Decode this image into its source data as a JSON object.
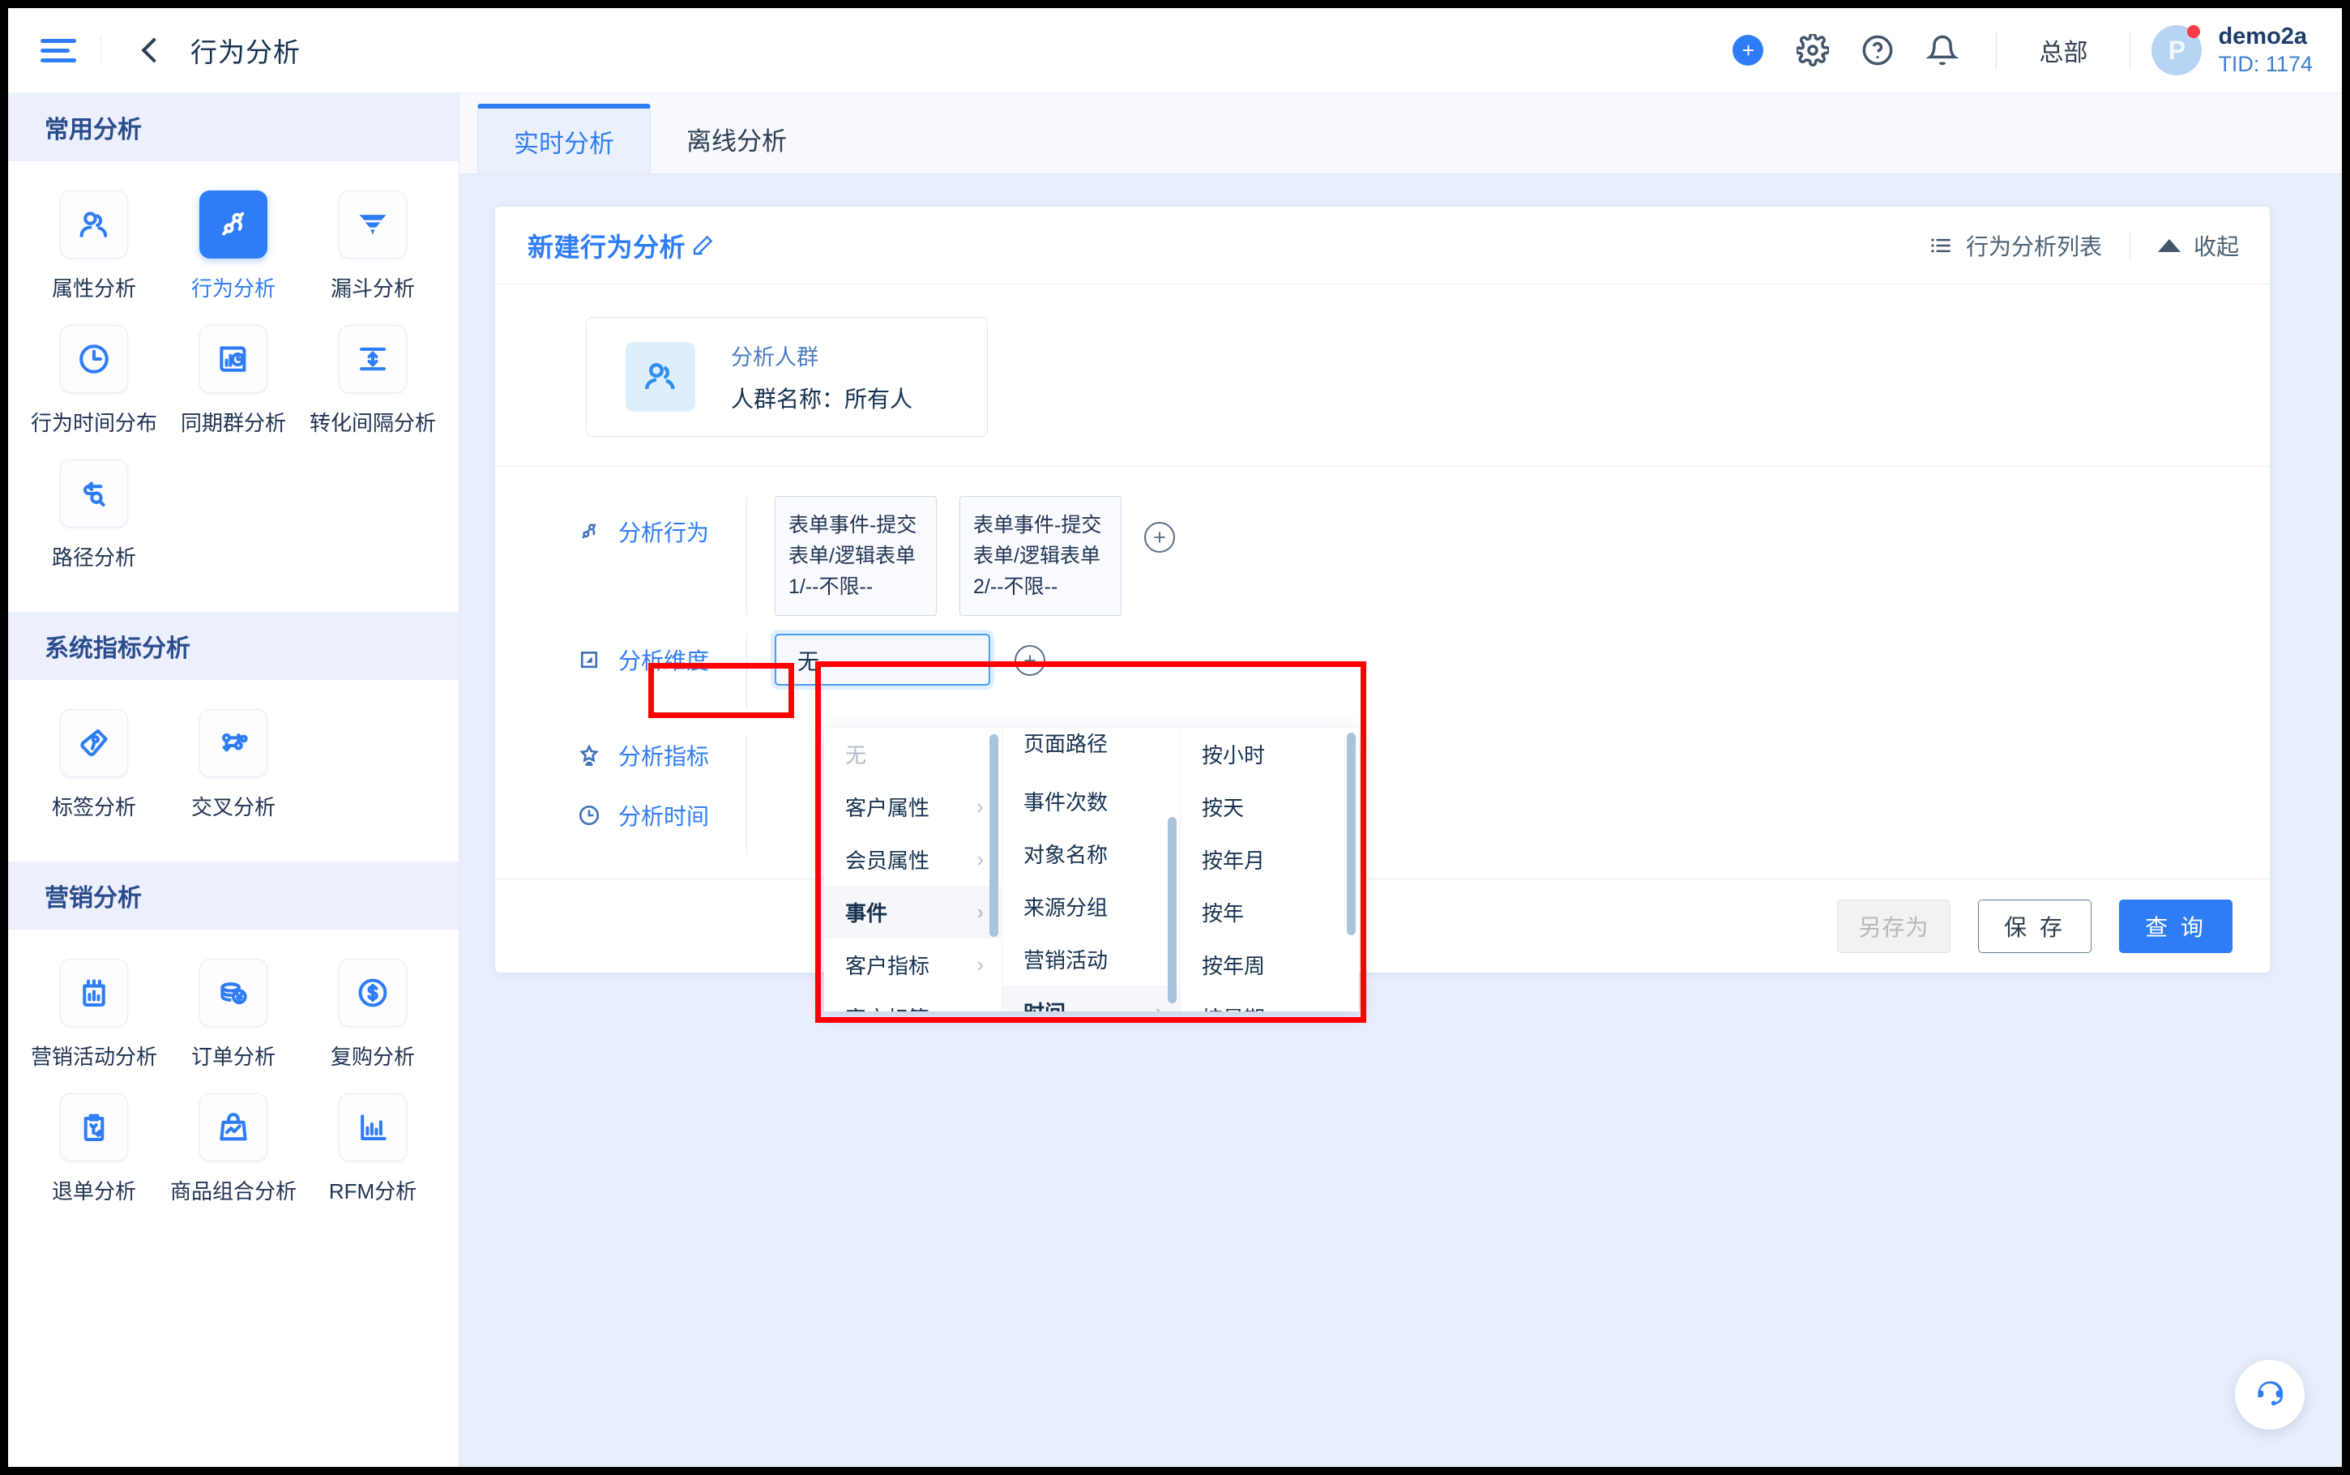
{
  "topbar": {
    "menu_icon": "hamburger-icon",
    "back_icon": "back-chevron-icon",
    "title": "行为分析",
    "icons": [
      "plus-circle-icon",
      "gear-icon",
      "help-icon",
      "bell-icon"
    ],
    "org_label": "总部",
    "user": {
      "avatar_letter": "P",
      "name": "demo2a",
      "tid": "TID: 1174"
    }
  },
  "sidebar": {
    "sections": [
      {
        "title": "常用分析",
        "items": [
          {
            "label": "属性分析",
            "icon": "user-group-icon",
            "active": false
          },
          {
            "label": "行为分析",
            "icon": "behavior-node-icon",
            "active": true
          },
          {
            "label": "漏斗分析",
            "icon": "funnel-icon",
            "active": false
          },
          {
            "label": "行为时间分布",
            "icon": "clock-icon",
            "active": false
          },
          {
            "label": "同期群分析",
            "icon": "chart-clock-icon",
            "active": false
          },
          {
            "label": "转化间隔分析",
            "icon": "arrow-updown-icon",
            "active": false
          },
          {
            "label": "路径分析",
            "icon": "path-search-icon",
            "active": false
          }
        ]
      },
      {
        "title": "系统指标分析",
        "items": [
          {
            "label": "标签分析",
            "icon": "tag-icon",
            "active": false
          },
          {
            "label": "交叉分析",
            "icon": "cross-node-icon",
            "active": false
          }
        ]
      },
      {
        "title": "营销分析",
        "items": [
          {
            "label": "营销活动分析",
            "icon": "campaign-chart-icon",
            "active": false
          },
          {
            "label": "订单分析",
            "icon": "coins-yuan-icon",
            "active": false
          },
          {
            "label": "复购分析",
            "icon": "dollar-circle-icon",
            "active": false
          },
          {
            "label": "退单分析",
            "icon": "refund-clipboard-icon",
            "active": false
          },
          {
            "label": "商品组合分析",
            "icon": "shopping-bag-icon",
            "active": false
          },
          {
            "label": "RFM分析",
            "icon": "bar-chart-icon",
            "active": false
          }
        ]
      }
    ]
  },
  "main": {
    "tabs": [
      {
        "label": "实时分析",
        "active": true
      },
      {
        "label": "离线分析",
        "active": false
      }
    ],
    "card": {
      "title": "新建行为分析",
      "edit_icon": "pencil-icon",
      "list_icon": "list-icon",
      "list_label": "行为分析列表",
      "collapse_icon": "caret-up-icon",
      "collapse_label": "收起"
    },
    "crowd": {
      "icon": "user-group-icon",
      "title": "分析人群",
      "name_line": "人群名称：所有人"
    },
    "rows": [
      {
        "key": "behavior",
        "icon": "behavior-node-icon",
        "label": "分析行为",
        "tags": [
          "表单事件-提交表单/逻辑表单1/--不限--",
          "表单事件-提交表单/逻辑表单2/--不限--"
        ],
        "add_icon": "plus-circle-outline-icon"
      },
      {
        "key": "dimension",
        "icon": "dimension-icon",
        "label": "分析维度",
        "input_value": "无",
        "add_icon": "plus-circle-outline-icon"
      },
      {
        "key": "metric",
        "icon": "star-trophy-icon",
        "label": "分析指标"
      },
      {
        "key": "time",
        "icon": "clock-icon",
        "label": "分析时间"
      }
    ],
    "cascader": {
      "col1": [
        {
          "label": "无",
          "muted": true,
          "arrow": false,
          "selected": false
        },
        {
          "label": "客户属性",
          "muted": false,
          "arrow": true,
          "selected": false
        },
        {
          "label": "会员属性",
          "muted": false,
          "arrow": true,
          "selected": false
        },
        {
          "label": "事件",
          "muted": false,
          "arrow": true,
          "selected": true
        },
        {
          "label": "客户指标",
          "muted": false,
          "arrow": true,
          "selected": false
        },
        {
          "label": "客户标签",
          "muted": false,
          "arrow": true,
          "selected": false
        }
      ],
      "col2": [
        {
          "label": "页面路径",
          "muted": false,
          "arrow": false,
          "selected": false
        },
        {
          "label": "事件次数",
          "muted": false,
          "arrow": false,
          "selected": false
        },
        {
          "label": "对象名称",
          "muted": false,
          "arrow": false,
          "selected": false
        },
        {
          "label": "来源分组",
          "muted": false,
          "arrow": false,
          "selected": false
        },
        {
          "label": "营销活动",
          "muted": false,
          "arrow": false,
          "selected": false
        },
        {
          "label": "时间",
          "muted": false,
          "arrow": true,
          "selected": true
        }
      ],
      "col3": [
        {
          "label": "按小时",
          "muted": false,
          "arrow": false,
          "selected": false
        },
        {
          "label": "按天",
          "muted": false,
          "arrow": false,
          "selected": false
        },
        {
          "label": "按年月",
          "muted": false,
          "arrow": false,
          "selected": false
        },
        {
          "label": "按年",
          "muted": false,
          "arrow": false,
          "selected": false
        },
        {
          "label": "按年周",
          "muted": false,
          "arrow": false,
          "selected": false
        },
        {
          "label": "按星期",
          "muted": false,
          "arrow": false,
          "selected": false
        }
      ]
    },
    "footer": {
      "save_as": "另存为",
      "save": "保 存",
      "query": "查 询"
    },
    "fab_icon": "headset-support-icon"
  },
  "colors": {
    "accent": "#2f7df6",
    "highlight": "#ff0000",
    "page_bg": "#e8eefb",
    "section_head_bg": "#eceffc"
  }
}
